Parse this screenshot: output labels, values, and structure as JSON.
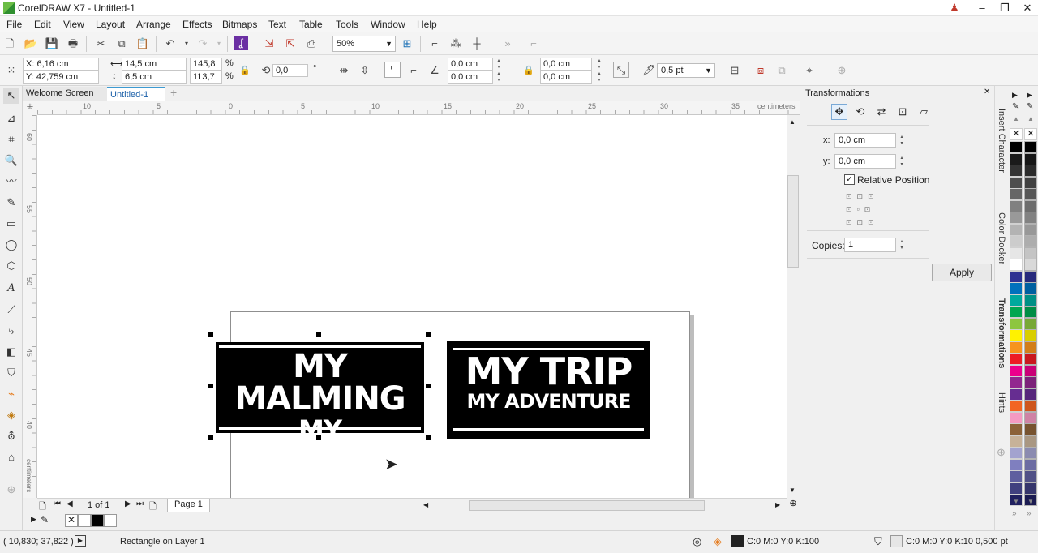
{
  "app": {
    "title": "CorelDRAW X7 - Untitled-1"
  },
  "menu": [
    "File",
    "Edit",
    "View",
    "Layout",
    "Arrange",
    "Effects",
    "Bitmaps",
    "Text",
    "Table",
    "Tools",
    "Window",
    "Help"
  ],
  "standard_toolbar": {
    "zoom": "50%"
  },
  "property_bar": {
    "x": "X: 6,16 cm",
    "y": "Y: 42,759 cm",
    "width": "14,5 cm",
    "height": "6,5 cm",
    "scale_w": "145,8",
    "scale_h": "113,7",
    "percent": "%",
    "rotation": "0,0",
    "degree": "°",
    "corner_tl": "0,0 cm",
    "corner_bl": "0,0 cm",
    "corner_tr": "0,0 cm",
    "corner_br": "0,0 cm",
    "outline_width": "0,5 pt"
  },
  "doc_tabs": [
    "Welcome Screen",
    "Untitled-1"
  ],
  "ruler": {
    "h_labels": [
      "10",
      "5",
      "0",
      "5",
      "10",
      "15",
      "20",
      "25",
      "30",
      "35"
    ],
    "h_unit": "centimeters",
    "v_labels": [
      "60",
      "55",
      "50",
      "45",
      "40"
    ],
    "v_unit": "centimeters"
  },
  "artwork": {
    "left_line1": "MY MALMING",
    "left_line2": "MY ADVENTURE",
    "right_line1": "MY TRIP",
    "right_line2": "MY ADVENTURE"
  },
  "page_nav": {
    "counter": "1 of 1",
    "page_tab": "Page 1"
  },
  "status": {
    "coords": "( 10,830; 37,822 )",
    "object": "Rectangle on Layer 1",
    "fill": "C:0 M:0 Y:0 K:100",
    "outline": "C:0 M:0 Y:0 K:10  0,500 pt"
  },
  "docker": {
    "title": "Transformations",
    "x_label": "x:",
    "x_value": "0,0 cm",
    "y_label": "y:",
    "y_value": "0,0 cm",
    "relative_position": "Relative Position",
    "copies_label": "Copies:",
    "copies_value": "1",
    "apply": "Apply"
  },
  "docker_tabs": [
    "Insert Character",
    "Color Docker",
    "Transformations",
    "Hints"
  ],
  "palette_colors": [
    "#000000",
    "#1a1a1a",
    "#333333",
    "#4d4d4d",
    "#666666",
    "#808080",
    "#999999",
    "#b3b3b3",
    "#cccccc",
    "#e6e6e6",
    "#ffffff",
    "#2e3192",
    "#0071bc",
    "#00a99d",
    "#00a651",
    "#8dc63f",
    "#fff200",
    "#f7941d",
    "#ed1c24",
    "#ec008c",
    "#92278f",
    "#662d91",
    "#f26522",
    "#f49ac2",
    "#8c6239",
    "#c7b299",
    "#a3a3cf",
    "#7f7fbf",
    "#5f5f9f",
    "#40407f",
    "#20205f"
  ]
}
